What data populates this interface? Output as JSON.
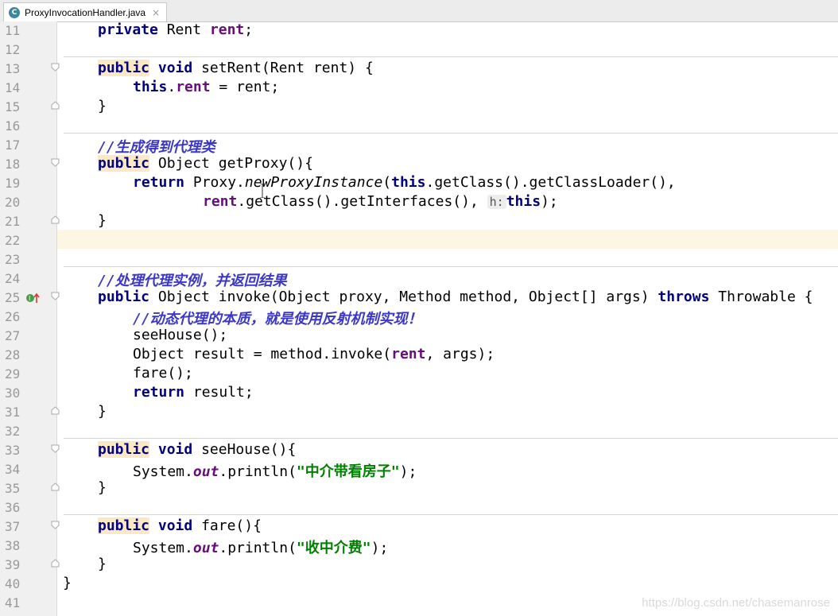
{
  "tab": {
    "icon_letter": "C",
    "label": "ProxyInvocationHandler.java",
    "close": "×"
  },
  "colors": {
    "keyword": "#000080",
    "field": "#660e7a",
    "string": "#008000",
    "comment": "#3b37c7",
    "gutter_bg": "#f0f0f0",
    "caret_line": "#fcf6e3"
  },
  "icons": {
    "tab": "java-class-icon",
    "override": "override-method-icon",
    "fold": "fold-marker-icon"
  },
  "gutter": {
    "line_numbers": [
      "11",
      "12",
      "13",
      "14",
      "15",
      "16",
      "17",
      "18",
      "19",
      "20",
      "21",
      "22",
      "23",
      "24",
      "25",
      "26",
      "27",
      "28",
      "29",
      "30",
      "31",
      "32",
      "33",
      "34",
      "35",
      "36",
      "37",
      "38",
      "39",
      "40",
      "41"
    ]
  },
  "code": {
    "l11": {
      "kw": "private",
      "type": " Rent ",
      "field": "rent",
      "end": ";"
    },
    "l13": {
      "kw1": "public",
      "kw2": "void",
      "rest": " setRent(Rent rent) {"
    },
    "l14": {
      "kw": "this",
      "dot": ".",
      "field": "rent",
      "rest": " = rent;"
    },
    "l15": "}",
    "l17": "//生成得到代理类",
    "l18": {
      "kw": "public",
      "rest": " Object getProxy(){"
    },
    "l19": {
      "kw": "return",
      "p1": " Proxy.",
      "method": "newProxyInstance",
      "p2": "(",
      "kw2": "this",
      "p3": ".getClass().getClassLoader(),"
    },
    "l20": {
      "field": "rent",
      "p1": ".getClass().getInterfaces(), ",
      "hint": "h:",
      "kw": "this",
      "p2": ");"
    },
    "l21": "}",
    "l24": "//处理代理实例，并返回结果",
    "l25": {
      "kw": "public",
      "p1": " Object invoke(Object proxy, Method method, Object[] args) ",
      "kw2": "throws",
      "p2": " Throwable {"
    },
    "l26": "//动态代理的本质，就是使用反射机制实现！",
    "l27": "seeHouse();",
    "l28": {
      "p1": "Object result = method.invoke(",
      "field": "rent",
      "p2": ", args);"
    },
    "l29": "fare();",
    "l30": {
      "kw": "return",
      "rest": " result;"
    },
    "l31": "}",
    "l33": {
      "kw1": "public",
      "kw2": "void",
      "rest": " seeHouse(){"
    },
    "l34": {
      "p1": "System.",
      "field": "out",
      "p2": ".println(",
      "str": "\"中介带看房子\"",
      "p3": ");"
    },
    "l35": "}",
    "l37": {
      "kw1": "public",
      "kw2": "void",
      "rest": " fare(){"
    },
    "l38": {
      "p1": "System.",
      "field": "out",
      "p2": ".println(",
      "str": "\"收中介费\"",
      "p3": ");"
    },
    "l39": "}",
    "l40": "}"
  },
  "watermark": "https://blog.csdn.net/chasemanrose"
}
